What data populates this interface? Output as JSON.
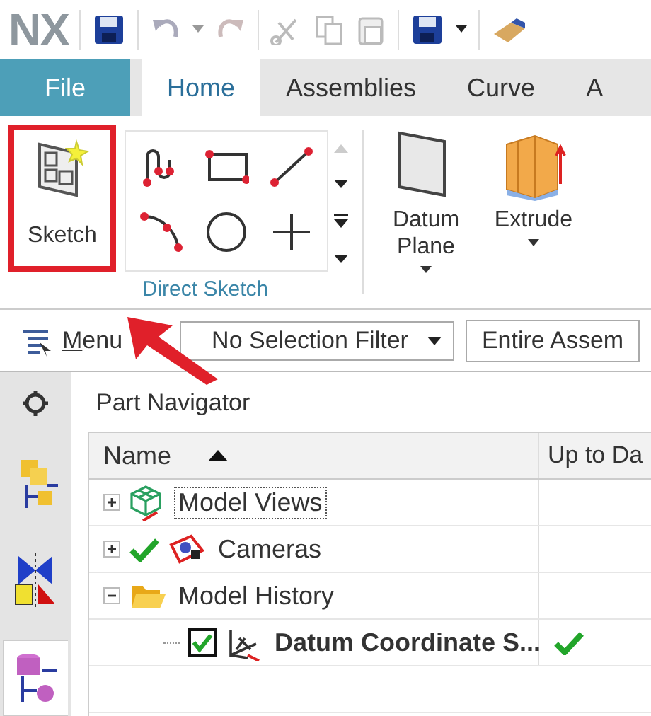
{
  "quick_access": {
    "logo": "NX"
  },
  "ribbon": {
    "tabs": [
      {
        "label": "File",
        "kind": "file",
        "selected": false
      },
      {
        "label": "Home",
        "kind": "tab",
        "selected": true
      },
      {
        "label": "Assemblies",
        "kind": "tab",
        "selected": false
      },
      {
        "label": "Curve",
        "kind": "tab",
        "selected": false
      },
      {
        "label": "A",
        "kind": "tab",
        "selected": false
      }
    ],
    "sketch_button": {
      "label": "Sketch",
      "highlighted": true
    },
    "group_label": "Direct Sketch",
    "buttons": [
      {
        "label": "Datum Plane",
        "kind": "plane"
      },
      {
        "label": "Extrude",
        "kind": "extrude"
      }
    ]
  },
  "toolbar": {
    "menu": "Menu",
    "filter": "No Selection Filter",
    "scope": "Entire Assem"
  },
  "resource_bar": {
    "tabs": [
      {
        "kind": "assembly",
        "selected": false
      },
      {
        "kind": "constraints",
        "selected": false
      },
      {
        "kind": "part",
        "selected": true
      }
    ]
  },
  "navigator": {
    "title": "Part Navigator",
    "columns": [
      {
        "label": "Name",
        "sorted": true
      },
      {
        "label": "Up to Da",
        "sorted": false
      }
    ],
    "rows": [
      {
        "name": "Model Views",
        "kind": "views",
        "expanded": false,
        "focused": true
      },
      {
        "name": "Cameras",
        "kind": "cameras",
        "expanded": false,
        "current": true,
        "focused": false
      },
      {
        "name": "Model History",
        "kind": "folder",
        "expanded": true,
        "focused": false,
        "children": [
          {
            "name": "Datum Coordinate S...",
            "kind": "datum",
            "checked": true,
            "emphasized": true,
            "up_to_date": true,
            "focused": false
          }
        ]
      }
    ]
  }
}
